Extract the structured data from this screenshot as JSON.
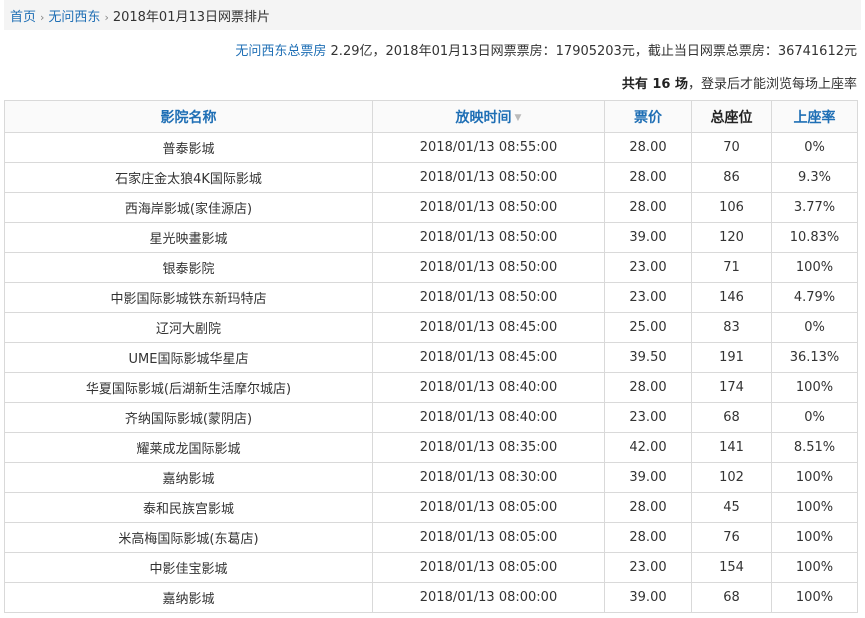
{
  "breadcrumb": {
    "home": "首页",
    "sep1": "›",
    "movie": "无问西东",
    "sep2": "›",
    "current": "2018年01月13日网票排片"
  },
  "summary": {
    "box_office_link": "无问西东总票房",
    "box_office_value": " 2.29亿，2018年01月13日网票票房：17905203元，截止当日网票总票房：36741612元"
  },
  "count": {
    "prefix": "共有 16 场",
    "suffix": "，登录后才能浏览每场上座率"
  },
  "table": {
    "headers": {
      "cinema": "影院名称",
      "time": "放映时间",
      "sort_icon": "▼",
      "price": "票价",
      "seats": "总座位",
      "rate": "上座率"
    },
    "rows": [
      {
        "cinema": "普泰影城",
        "time": "2018/01/13 08:55:00",
        "price": "28.00",
        "seats": "70",
        "rate": "0%"
      },
      {
        "cinema": "石家庄金太狼4K国际影城",
        "time": "2018/01/13 08:50:00",
        "price": "28.00",
        "seats": "86",
        "rate": "9.3%"
      },
      {
        "cinema": "西海岸影城(家佳源店)",
        "time": "2018/01/13 08:50:00",
        "price": "28.00",
        "seats": "106",
        "rate": "3.77%"
      },
      {
        "cinema": "星光映畫影城",
        "time": "2018/01/13 08:50:00",
        "price": "39.00",
        "seats": "120",
        "rate": "10.83%"
      },
      {
        "cinema": "银泰影院",
        "time": "2018/01/13 08:50:00",
        "price": "23.00",
        "seats": "71",
        "rate": "100%"
      },
      {
        "cinema": "中影国际影城铁东新玛特店",
        "time": "2018/01/13 08:50:00",
        "price": "23.00",
        "seats": "146",
        "rate": "4.79%"
      },
      {
        "cinema": "辽河大剧院",
        "time": "2018/01/13 08:45:00",
        "price": "25.00",
        "seats": "83",
        "rate": "0%"
      },
      {
        "cinema": "UME国际影城华星店",
        "time": "2018/01/13 08:45:00",
        "price": "39.50",
        "seats": "191",
        "rate": "36.13%"
      },
      {
        "cinema": "华夏国际影城(后湖新生活摩尔城店)",
        "time": "2018/01/13 08:40:00",
        "price": "28.00",
        "seats": "174",
        "rate": "100%"
      },
      {
        "cinema": "齐纳国际影城(蒙阴店)",
        "time": "2018/01/13 08:40:00",
        "price": "23.00",
        "seats": "68",
        "rate": "0%"
      },
      {
        "cinema": "耀莱成龙国际影城",
        "time": "2018/01/13 08:35:00",
        "price": "42.00",
        "seats": "141",
        "rate": "8.51%"
      },
      {
        "cinema": "嘉纳影城",
        "time": "2018/01/13 08:30:00",
        "price": "39.00",
        "seats": "102",
        "rate": "100%"
      },
      {
        "cinema": "泰和民族宫影城",
        "time": "2018/01/13 08:05:00",
        "price": "28.00",
        "seats": "45",
        "rate": "100%"
      },
      {
        "cinema": "米高梅国际影城(东葛店)",
        "time": "2018/01/13 08:05:00",
        "price": "28.00",
        "seats": "76",
        "rate": "100%"
      },
      {
        "cinema": "中影佳宝影城",
        "time": "2018/01/13 08:05:00",
        "price": "23.00",
        "seats": "154",
        "rate": "100%"
      },
      {
        "cinema": "嘉纳影城",
        "time": "2018/01/13 08:00:00",
        "price": "39.00",
        "seats": "68",
        "rate": "100%"
      }
    ]
  }
}
